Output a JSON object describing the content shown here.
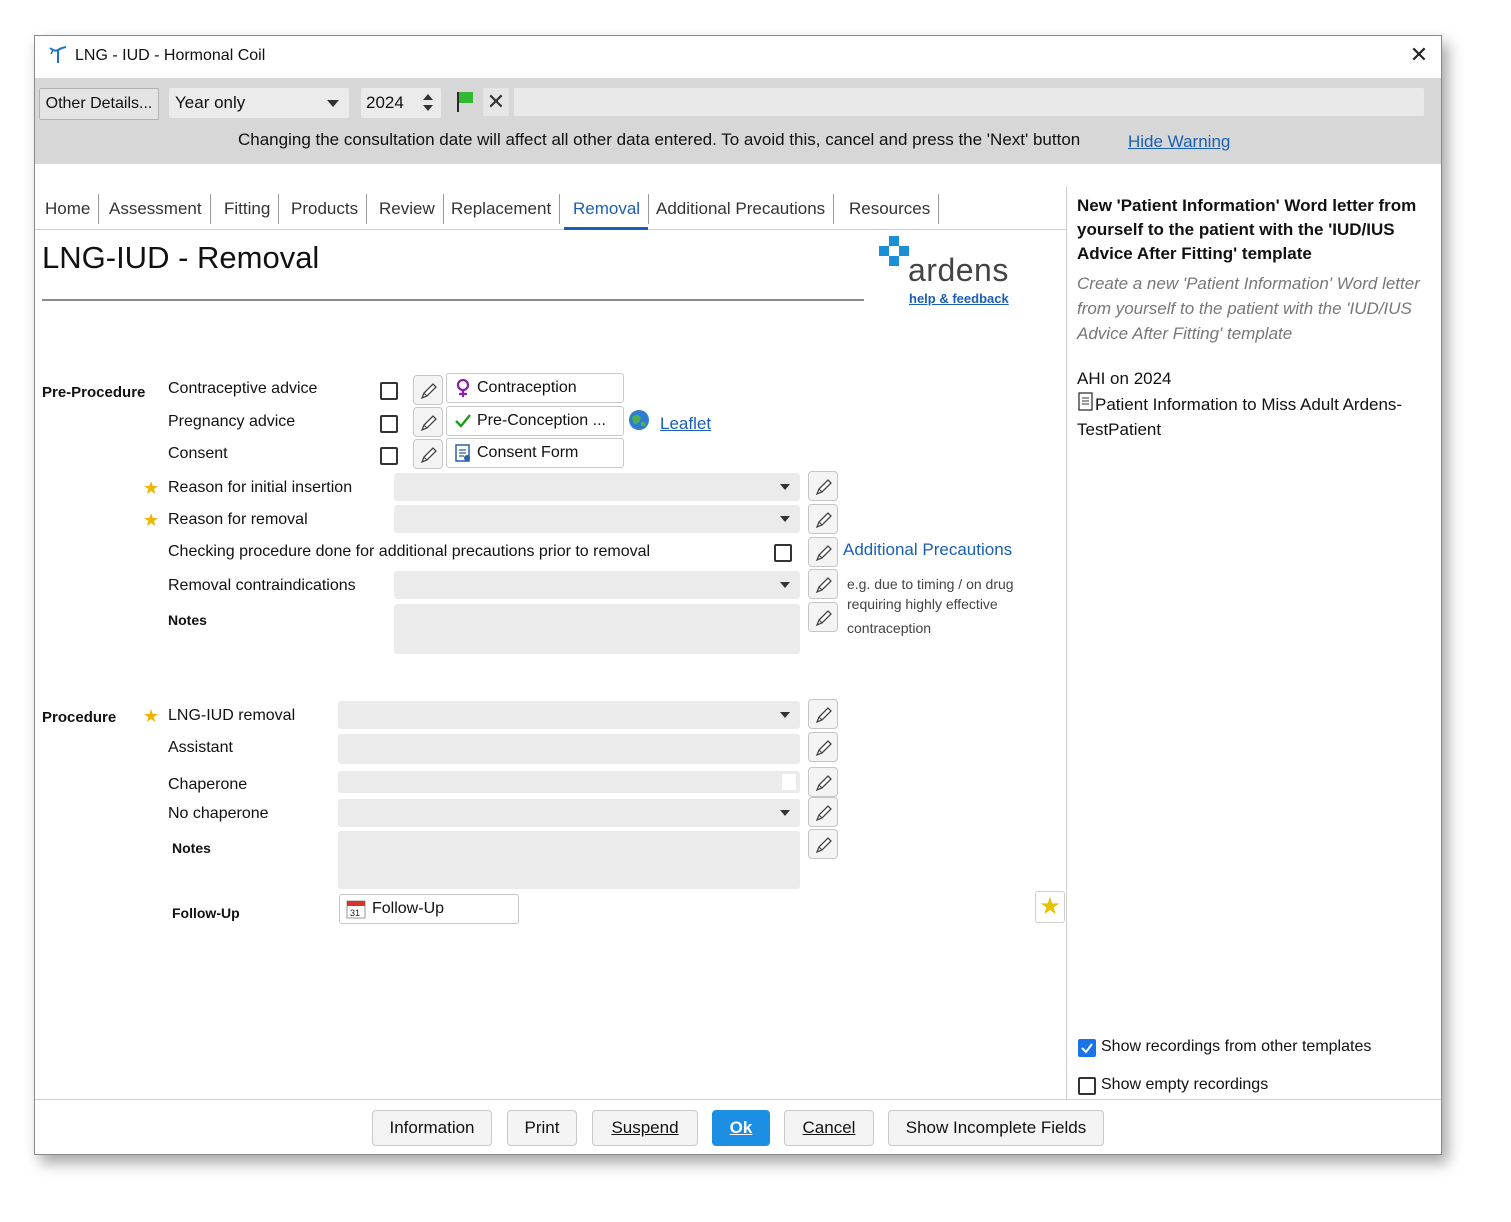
{
  "window": {
    "title": "LNG - IUD - Hormonal Coil"
  },
  "toolbar": {
    "other_details": "Other Details...",
    "date_mode": "Year only",
    "year": "2024",
    "warning": "Changing the consultation date will affect all other data entered. To avoid this, cancel and press the 'Next' button",
    "hide_warning": "Hide Warning"
  },
  "tabs": [
    "Home",
    "Assessment",
    "Fitting",
    "Products",
    "Review",
    "Replacement",
    "Removal",
    "Additional Precautions",
    "Resources"
  ],
  "active_tab": "Removal",
  "page_title": "LNG-IUD - Removal",
  "logo": {
    "name": "ardens",
    "link": "help & feedback"
  },
  "pre_procedure": {
    "section": "Pre-Procedure",
    "contraceptive_advice": "Contraceptive advice",
    "pregnancy_advice": "Pregnancy advice",
    "consent": "Consent",
    "chip_contraception": "Contraception",
    "chip_preconception": "Pre-Conception ...",
    "chip_consent": "Consent Form",
    "leaflet": "Leaflet",
    "reason_initial": "Reason for initial insertion",
    "reason_removal": "Reason for removal",
    "checking_procedure": "Checking procedure done for additional precautions prior to removal",
    "additional_precautions_link": "Additional Precautions",
    "removal_contra": "Removal contraindications",
    "hint_line1": "e.g. due to timing / on drug",
    "hint_line2": "requiring highly effective",
    "hint_line3": "contraception",
    "notes": "Notes"
  },
  "procedure": {
    "section": "Procedure",
    "removal": "LNG-IUD removal",
    "assistant": "Assistant",
    "chaperone": "Chaperone",
    "no_chaperone": "No chaperone",
    "notes": "Notes",
    "follow_up_label": "Follow-Up",
    "follow_up_button": "Follow-Up",
    "calendar_day": "31"
  },
  "right_panel": {
    "title": "New 'Patient Information' Word letter from yourself to the patient with the 'IUD/IUS Advice After Fitting' template",
    "description": "Create a new 'Patient Information' Word letter from yourself to the patient with the 'IUD/IUS Advice After Fitting' template",
    "ahi": "AHI on 2024",
    "entry": "Patient Information to Miss Adult Ardens-TestPatient",
    "show_other": "Show recordings from other templates",
    "show_other_checked": true,
    "show_empty": "Show empty recordings",
    "show_empty_checked": false
  },
  "buttons": {
    "information": "Information",
    "print": "Print",
    "suspend": "Suspend",
    "ok": "Ok",
    "cancel": "Cancel",
    "show_incomplete": "Show Incomplete Fields"
  },
  "colors": {
    "accent": "#1a5fb4",
    "ok_button": "#1a8fe3",
    "star": "#f0b400"
  }
}
